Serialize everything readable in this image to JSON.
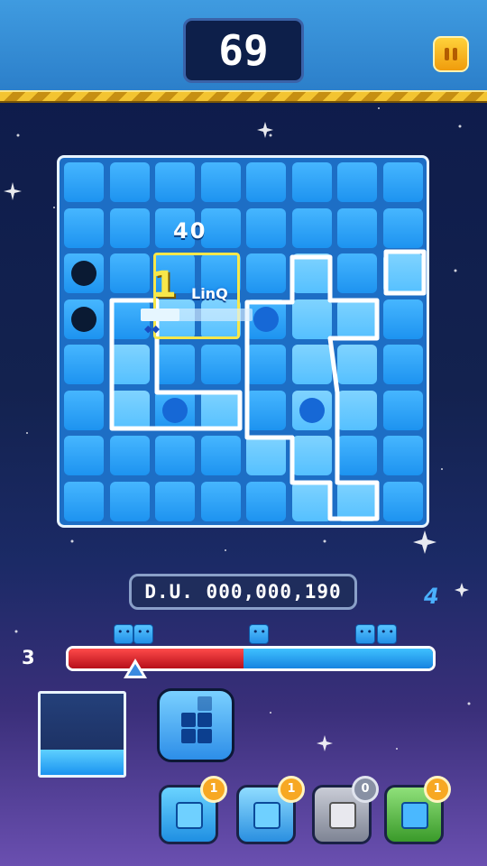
{
  "hud": {
    "timer": "69",
    "pause_icon": "pause-icon"
  },
  "board": {
    "rows": 8,
    "cols": 8,
    "dark_cells": [
      [
        2,
        0
      ],
      [
        3,
        0
      ]
    ],
    "dot_cells": [
      [
        3,
        4
      ],
      [
        5,
        2
      ],
      [
        5,
        5
      ]
    ],
    "combo_points": "40",
    "selection": {
      "count": "1",
      "tag": "LinQ",
      "fill": 0.35
    }
  },
  "score": {
    "du": "D.U. 000,000,190",
    "right_count": "4",
    "left_count": "3"
  },
  "meter": {
    "red_fraction": 0.48,
    "marker_fraction": 0.19
  },
  "skills": [
    {
      "name": "splash-cube-skill",
      "badge": "1"
    },
    {
      "name": "frozen-cube-skill",
      "badge": "1"
    },
    {
      "name": "stone-golem-skill",
      "badge": "0"
    },
    {
      "name": "monster-box-skill",
      "badge": "1"
    }
  ],
  "colors": {
    "accent": "#2b7ec9",
    "gold": "#f3c431",
    "danger": "#d41c25",
    "ally": "#22a2f5"
  }
}
